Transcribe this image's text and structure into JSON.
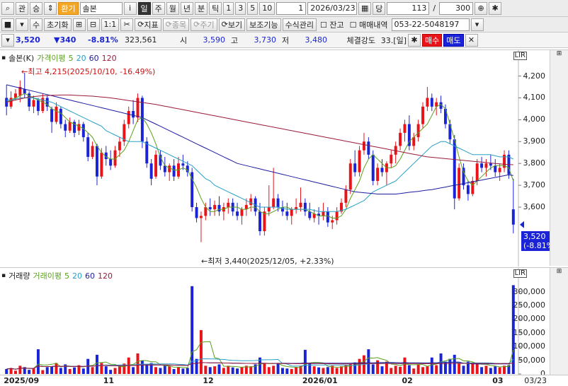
{
  "toolbar1": {
    "search_icon": "search-icon",
    "btn_gwan": "관",
    "btn_seung": "승",
    "btn_hangi": "환기",
    "stock_name": "솔본",
    "btn_i": "i",
    "periods": [
      "일",
      "주",
      "월",
      "년",
      "분",
      "틱"
    ],
    "nums": [
      "1",
      "3",
      "5",
      "10"
    ],
    "count": "1",
    "date": "2026/03/23",
    "btn_dang": "당",
    "num1": "113",
    "slash": "/",
    "num2": "300",
    "zoom_icon": "zoom-in-icon",
    "gear_icon": "gear-icon"
  },
  "toolbar2": {
    "btn_su": "수",
    "btn_init": "초기화",
    "btn_11": "1:1",
    "btn_jipyo": "지표",
    "btn_jongmok": "종목",
    "btn_jugi": "주기",
    "btn_bogi": "보기",
    "btn_bojo": "보조기능",
    "btn_susik": "수식관리",
    "chk_jango": "잔고",
    "chk_maemae": "매매내역",
    "account": "053-22-5048197"
  },
  "quote": {
    "price": "3,520",
    "change": "▼340",
    "pct": "-8.81%",
    "volume": "323,561",
    "si_label": "시",
    "si": "3,590",
    "go_label": "고",
    "go": "3,730",
    "jeo_label": "저",
    "jeo": "3,480",
    "strength_label": "체결강도",
    "strength": "33.[일]",
    "sell": "매수",
    "buy": "매도"
  },
  "price_legend": {
    "name": "솔본(K)",
    "ma_label": "가격이평",
    "p5": "5",
    "p20": "20",
    "p60": "60",
    "p120": "120"
  },
  "vol_legend": {
    "name": "거래량",
    "ma_label": "거래이평",
    "p5": "5",
    "p20": "20",
    "p60": "60",
    "p120": "120"
  },
  "annotations": {
    "high": "←최고 4,215(2025/10/10, -16.49%)",
    "low": "←최저 3,440(2025/12/05, +2.33%)",
    "cur_price": "3,520",
    "cur_pct": "(-8.81%)",
    "lir": "LIR"
  },
  "price_axis": [
    "4,200",
    "4,100",
    "4,000",
    "3,900",
    "3,800",
    "3,700",
    "3,600"
  ],
  "vol_axis": [
    "300,000",
    "250,000",
    "200,000",
    "150,000",
    "100,000",
    "50,000",
    "0"
  ],
  "x_axis": [
    "2025/09",
    "11",
    "12",
    "2026/01",
    "02",
    "03",
    "03/23"
  ],
  "colors": {
    "up": "#e8141a",
    "down": "#1a24d6",
    "ma5": "#5aa01e",
    "ma20": "#28a0c8",
    "ma60": "#1c1ca0",
    "ma120": "#9a1a3a"
  },
  "chart_data": {
    "type": "candlestick",
    "ylim": [
      3380,
      4260
    ],
    "candles": [
      [
        4100,
        4160,
        4020,
        4060
      ],
      [
        4060,
        4130,
        4050,
        4100
      ],
      [
        4100,
        4140,
        4090,
        4120
      ],
      [
        4110,
        4180,
        4080,
        4150
      ],
      [
        4140,
        4215,
        4100,
        4120
      ],
      [
        4120,
        4130,
        4040,
        4060
      ],
      [
        4060,
        4110,
        4030,
        4090
      ],
      [
        4090,
        4100,
        4020,
        4040
      ],
      [
        4040,
        4120,
        4030,
        4100
      ],
      [
        4100,
        4110,
        4040,
        4060
      ],
      [
        4050,
        4060,
        3940,
        3990
      ],
      [
        3990,
        4080,
        3980,
        4060
      ],
      [
        4050,
        4060,
        3960,
        3980
      ],
      [
        3980,
        4000,
        3920,
        3950
      ],
      [
        3950,
        4010,
        3940,
        3990
      ],
      [
        3990,
        4000,
        3920,
        3940
      ],
      [
        3950,
        4000,
        3930,
        3980
      ],
      [
        3980,
        3990,
        3900,
        3920
      ],
      [
        3920,
        3940,
        3810,
        3830
      ],
      [
        3830,
        3900,
        3820,
        3880
      ],
      [
        3880,
        3890,
        3700,
        3740
      ],
      [
        3740,
        3870,
        3730,
        3850
      ],
      [
        3850,
        3880,
        3790,
        3820
      ],
      [
        3820,
        3860,
        3770,
        3790
      ],
      [
        3790,
        3880,
        3780,
        3860
      ],
      [
        3860,
        3920,
        3830,
        3900
      ],
      [
        3900,
        4000,
        3880,
        3980
      ],
      [
        3980,
        4060,
        3960,
        4040
      ],
      [
        4040,
        4090,
        3980,
        4010
      ],
      [
        4010,
        4120,
        3990,
        4100
      ],
      [
        4100,
        4110,
        3870,
        3900
      ],
      [
        3900,
        3920,
        3780,
        3800
      ],
      [
        3800,
        3820,
        3700,
        3730
      ],
      [
        3740,
        3860,
        3730,
        3840
      ],
      [
        3840,
        3860,
        3770,
        3790
      ],
      [
        3790,
        3830,
        3740,
        3760
      ],
      [
        3760,
        3800,
        3720,
        3790
      ],
      [
        3790,
        3820,
        3720,
        3740
      ],
      [
        3740,
        3830,
        3730,
        3800
      ],
      [
        3800,
        3840,
        3770,
        3790
      ],
      [
        3790,
        3810,
        3740,
        3760
      ],
      [
        3760,
        3780,
        3580,
        3600
      ],
      [
        3600,
        3620,
        3530,
        3550
      ],
      [
        3550,
        3580,
        3440,
        3560
      ],
      [
        3560,
        3620,
        3540,
        3600
      ],
      [
        3600,
        3640,
        3560,
        3590
      ],
      [
        3590,
        3630,
        3560,
        3610
      ],
      [
        3610,
        3650,
        3560,
        3580
      ],
      [
        3580,
        3620,
        3540,
        3600
      ],
      [
        3600,
        3640,
        3570,
        3620
      ],
      [
        3620,
        3640,
        3560,
        3580
      ],
      [
        3580,
        3620,
        3540,
        3560
      ],
      [
        3560,
        3600,
        3520,
        3590
      ],
      [
        3590,
        3640,
        3560,
        3610
      ],
      [
        3610,
        3660,
        3580,
        3640
      ],
      [
        3640,
        3650,
        3560,
        3580
      ],
      [
        3580,
        3620,
        3470,
        3490
      ],
      [
        3490,
        3600,
        3470,
        3580
      ],
      [
        3580,
        3700,
        3560,
        3600
      ],
      [
        3600,
        3780,
        3590,
        3640
      ],
      [
        3640,
        3660,
        3580,
        3600
      ],
      [
        3600,
        3630,
        3560,
        3580
      ],
      [
        3580,
        3620,
        3540,
        3560
      ],
      [
        3560,
        3600,
        3520,
        3590
      ],
      [
        3590,
        3640,
        3570,
        3600
      ],
      [
        3600,
        3690,
        3580,
        3620
      ],
      [
        3620,
        3640,
        3560,
        3580
      ],
      [
        3580,
        3620,
        3540,
        3550
      ],
      [
        3550,
        3590,
        3530,
        3570
      ],
      [
        3570,
        3600,
        3520,
        3560
      ],
      [
        3560,
        3620,
        3540,
        3580
      ],
      [
        3580,
        3600,
        3510,
        3530
      ],
      [
        3530,
        3560,
        3500,
        3540
      ],
      [
        3540,
        3600,
        3520,
        3580
      ],
      [
        3580,
        3640,
        3570,
        3620
      ],
      [
        3620,
        3700,
        3600,
        3680
      ],
      [
        3680,
        3820,
        3660,
        3800
      ],
      [
        3800,
        3860,
        3740,
        3760
      ],
      [
        3760,
        3880,
        3740,
        3860
      ],
      [
        3860,
        3940,
        3840,
        3900
      ],
      [
        3900,
        3920,
        3820,
        3840
      ],
      [
        3840,
        3860,
        3700,
        3720
      ],
      [
        3720,
        3800,
        3700,
        3780
      ],
      [
        3780,
        3820,
        3740,
        3760
      ],
      [
        3760,
        3810,
        3700,
        3800
      ],
      [
        3800,
        3860,
        3780,
        3840
      ],
      [
        3840,
        3900,
        3800,
        3880
      ],
      [
        3880,
        3960,
        3860,
        3940
      ],
      [
        3940,
        4000,
        3900,
        3980
      ],
      [
        3980,
        4020,
        3860,
        3880
      ],
      [
        3880,
        3940,
        3860,
        3920
      ],
      [
        3920,
        4000,
        3900,
        3980
      ],
      [
        3980,
        4080,
        3960,
        4060
      ],
      [
        4060,
        4150,
        4040,
        4100
      ],
      [
        4100,
        4120,
        4040,
        4060
      ],
      [
        4060,
        4100,
        4020,
        4080
      ],
      [
        4080,
        4110,
        4030,
        4050
      ],
      [
        4050,
        4070,
        3960,
        3980
      ],
      [
        3980,
        4000,
        3890,
        3910
      ],
      [
        3910,
        3930,
        3590,
        3640
      ],
      [
        3640,
        3800,
        3630,
        3780
      ],
      [
        3780,
        3800,
        3680,
        3700
      ],
      [
        3700,
        3720,
        3630,
        3660
      ],
      [
        3660,
        3740,
        3650,
        3720
      ],
      [
        3720,
        3820,
        3700,
        3800
      ],
      [
        3800,
        3830,
        3760,
        3780
      ],
      [
        3780,
        3820,
        3740,
        3800
      ],
      [
        3800,
        3840,
        3770,
        3790
      ],
      [
        3790,
        3820,
        3740,
        3760
      ],
      [
        3760,
        3800,
        3720,
        3780
      ],
      [
        3780,
        3860,
        3760,
        3840
      ],
      [
        3840,
        3860,
        3730,
        3750
      ],
      [
        3590,
        3730,
        3480,
        3520
      ]
    ],
    "ma5": [
      4080,
      4090,
      4100,
      4110,
      4120,
      4110,
      4100,
      4090,
      4080,
      4070,
      4050,
      4040,
      4030,
      4010,
      3990,
      3980,
      3970,
      3960,
      3940,
      3920,
      3880,
      3850,
      3830,
      3820,
      3820,
      3840,
      3860,
      3900,
      3950,
      4000,
      4010,
      3980,
      3940,
      3890,
      3830,
      3790,
      3780,
      3770,
      3770,
      3780,
      3770,
      3730,
      3690,
      3640,
      3600,
      3580,
      3580,
      3590,
      3590,
      3600,
      3600,
      3600,
      3590,
      3590,
      3600,
      3600,
      3580,
      3570,
      3570,
      3580,
      3590,
      3600,
      3600,
      3590,
      3590,
      3590,
      3590,
      3580,
      3570,
      3560,
      3560,
      3560,
      3550,
      3550,
      3560,
      3590,
      3640,
      3680,
      3720,
      3780,
      3820,
      3840,
      3820,
      3800,
      3780,
      3780,
      3790,
      3820,
      3860,
      3900,
      3920,
      3940,
      3960,
      3980,
      4020,
      4060,
      4070,
      4050,
      3980,
      3910,
      3830,
      3760,
      3720,
      3700,
      3720,
      3740,
      3760,
      3780,
      3790,
      3790,
      3790,
      3780,
      3720
    ],
    "ma20": [
      4090,
      4090,
      4095,
      4100,
      4100,
      4100,
      4100,
      4095,
      4090,
      4085,
      4080,
      4070,
      4060,
      4050,
      4040,
      4030,
      4020,
      4010,
      4000,
      3990,
      3980,
      3970,
      3950,
      3940,
      3930,
      3920,
      3910,
      3900,
      3900,
      3900,
      3900,
      3890,
      3880,
      3870,
      3860,
      3850,
      3840,
      3830,
      3820,
      3810,
      3800,
      3790,
      3770,
      3750,
      3730,
      3720,
      3700,
      3690,
      3680,
      3670,
      3660,
      3650,
      3640,
      3630,
      3620,
      3610,
      3600,
      3600,
      3600,
      3600,
      3600,
      3595,
      3590,
      3590,
      3590,
      3590,
      3590,
      3590,
      3585,
      3580,
      3580,
      3580,
      3580,
      3580,
      3585,
      3590,
      3600,
      3610,
      3620,
      3630,
      3650,
      3670,
      3680,
      3690,
      3700,
      3710,
      3720,
      3740,
      3760,
      3780,
      3800,
      3820,
      3840,
      3860,
      3880,
      3890,
      3900,
      3900,
      3890,
      3880,
      3870,
      3860,
      3850,
      3840,
      3840,
      3840,
      3840,
      3840,
      3835,
      3830,
      3830,
      3830,
      3820
    ],
    "ma60": [
      4160,
      4155,
      4150,
      4145,
      4140,
      4135,
      4130,
      4125,
      4120,
      4115,
      4110,
      4105,
      4100,
      4095,
      4090,
      4085,
      4080,
      4075,
      4070,
      4065,
      4060,
      4055,
      4050,
      4045,
      4040,
      4035,
      4030,
      4025,
      4020,
      4015,
      4010,
      4000,
      3990,
      3980,
      3970,
      3960,
      3950,
      3940,
      3930,
      3920,
      3910,
      3900,
      3890,
      3880,
      3870,
      3860,
      3850,
      3840,
      3830,
      3820,
      3810,
      3800,
      3795,
      3790,
      3785,
      3780,
      3775,
      3770,
      3765,
      3760,
      3755,
      3750,
      3745,
      3740,
      3735,
      3730,
      3725,
      3720,
      3715,
      3710,
      3705,
      3700,
      3695,
      3690,
      3685,
      3680,
      3675,
      3670,
      3668,
      3666,
      3664,
      3662,
      3660,
      3660,
      3660,
      3660,
      3660,
      3662,
      3665,
      3668,
      3670,
      3672,
      3675,
      3678,
      3680,
      3684,
      3688,
      3692,
      3696,
      3700,
      3704,
      3708,
      3712,
      3716,
      3720,
      3724,
      3728,
      3732,
      3736,
      3740,
      3744,
      3748,
      3745
    ],
    "ma120": [
      4080,
      4085,
      4090,
      4095,
      4100,
      4103,
      4106,
      4108,
      4110,
      4111,
      4112,
      4112,
      4113,
      4113,
      4113,
      4112,
      4111,
      4110,
      4109,
      4108,
      4106,
      4104,
      4102,
      4100,
      4097,
      4094,
      4091,
      4088,
      4085,
      4082,
      4079,
      4076,
      4073,
      4070,
      4066,
      4062,
      4058,
      4054,
      4050,
      4046,
      4042,
      4038,
      4034,
      4030,
      4026,
      4022,
      4018,
      4014,
      4010,
      4006,
      4002,
      3998,
      3994,
      3990,
      3986,
      3982,
      3978,
      3974,
      3970,
      3966,
      3962,
      3958,
      3954,
      3950,
      3946,
      3942,
      3938,
      3934,
      3930,
      3926,
      3922,
      3918,
      3914,
      3910,
      3906,
      3902,
      3898,
      3894,
      3890,
      3886,
      3882,
      3878,
      3874,
      3870,
      3866,
      3862,
      3858,
      3854,
      3850,
      3846,
      3842,
      3838,
      3834,
      3830,
      3828,
      3826,
      3824,
      3822,
      3820,
      3818,
      3816,
      3814,
      3812,
      3810,
      3808,
      3806,
      3804,
      3802,
      3800,
      3798,
      3796,
      3795,
      3794
    ],
    "volume_ylim": [
      0,
      340000
    ],
    "volumes": [
      18000,
      22000,
      12000,
      30000,
      25000,
      15000,
      20000,
      90000,
      14000,
      25000,
      28000,
      40000,
      22000,
      35000,
      18000,
      24000,
      32000,
      20000,
      55000,
      25000,
      70000,
      40000,
      28000,
      15000,
      22000,
      30000,
      38000,
      60000,
      25000,
      75000,
      48000,
      35000,
      40000,
      25000,
      22000,
      30000,
      28000,
      18000,
      25000,
      20000,
      22000,
      320000,
      55000,
      160000,
      30000,
      25000,
      28000,
      35000,
      22000,
      30000,
      24000,
      20000,
      26000,
      30000,
      28000,
      35000,
      60000,
      40000,
      25000,
      30000,
      38000,
      22000,
      20000,
      18000,
      25000,
      30000,
      88000,
      40000,
      28000,
      24000,
      22000,
      25000,
      30000,
      22000,
      28000,
      32000,
      36000,
      42000,
      55000,
      68000,
      90000,
      35000,
      50000,
      28000,
      45000,
      22000,
      30000,
      26000,
      60000,
      32000,
      20000,
      35000,
      25000,
      28000,
      60000,
      32000,
      75000,
      45000,
      55000,
      70000,
      38000,
      30000,
      45000,
      36000,
      40000,
      25000,
      30000,
      22000,
      28000,
      24000,
      30000,
      32000,
      323561
    ]
  }
}
